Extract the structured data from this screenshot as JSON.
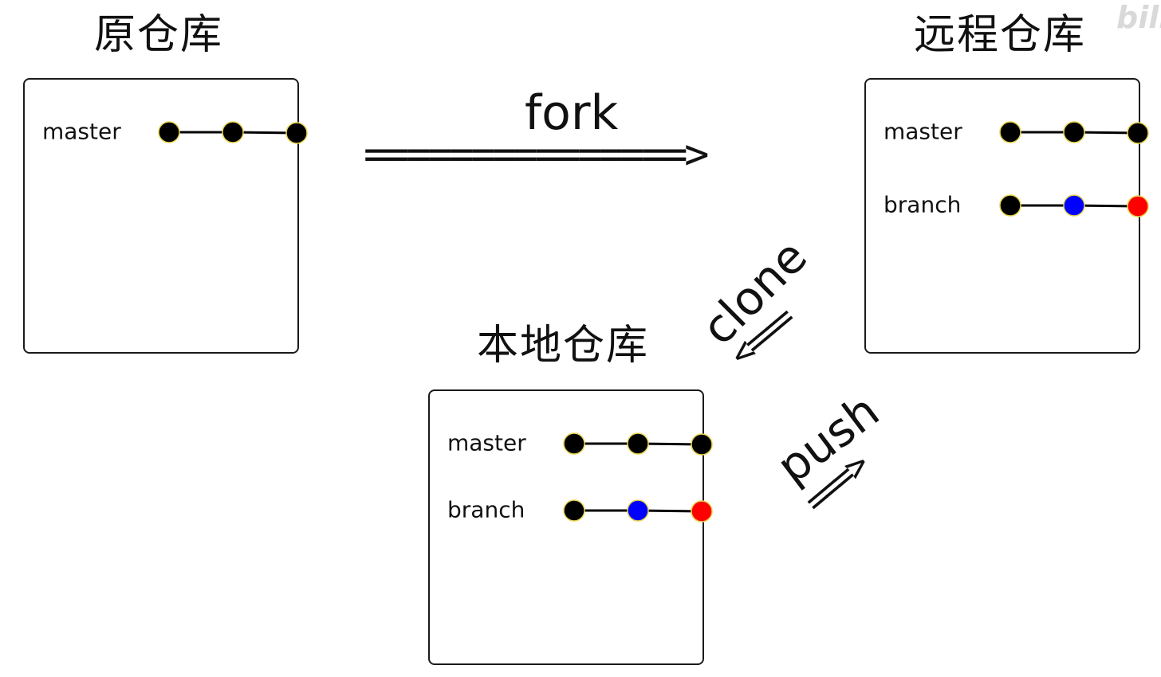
{
  "repos": {
    "original": {
      "title": "原仓库",
      "branches": [
        {
          "name": "master",
          "commits": [
            "#000000",
            "#000000",
            "#000000"
          ]
        }
      ]
    },
    "remote": {
      "title": "远程仓库",
      "branches": [
        {
          "name": "master",
          "commits": [
            "#000000",
            "#000000",
            "#000000"
          ]
        },
        {
          "name": "branch",
          "commits": [
            "#000000",
            "#0000ff",
            "#ff0000"
          ]
        }
      ]
    },
    "local": {
      "title": "本地仓库",
      "branches": [
        {
          "name": "master",
          "commits": [
            "#000000",
            "#000000",
            "#000000"
          ]
        },
        {
          "name": "branch",
          "commits": [
            "#000000",
            "#0000ff",
            "#ff0000"
          ]
        }
      ]
    }
  },
  "operations": {
    "fork": {
      "label": "fork",
      "arrow": "===============>"
    },
    "clone": {
      "label": "clone",
      "arrow": "<==="
    },
    "push": {
      "label": "push",
      "arrow": "===>"
    }
  },
  "colors": {
    "commit_default": "#000000",
    "commit_blue": "#0000ff",
    "commit_red": "#ff0000",
    "commit_outline": "#e8d44d",
    "line": "#000000"
  },
  "watermark": "bili"
}
